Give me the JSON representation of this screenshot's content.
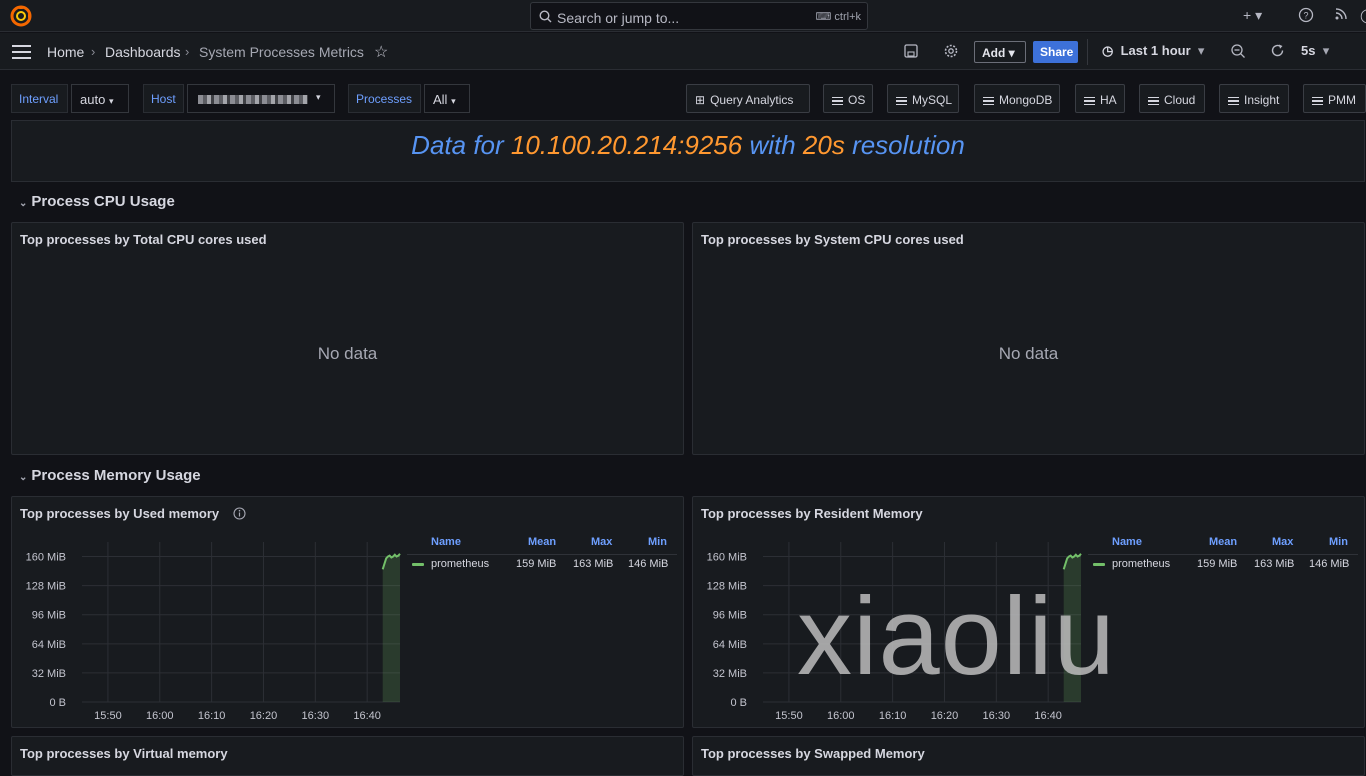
{
  "search": {
    "placeholder": "Search or jump to...",
    "shortcut": "ctrl+k"
  },
  "nav": {
    "breadcrumbs": [
      "Home",
      "Dashboards",
      "System Processes Metrics"
    ],
    "add_label": "Add",
    "share_label": "Share",
    "time_range": "Last 1 hour",
    "refresh_interval": "5s"
  },
  "variables": {
    "interval_label": "Interval",
    "interval_value": "auto",
    "host_label": "Host",
    "processes_label": "Processes",
    "processes_value": "All"
  },
  "links": [
    "Query Analytics",
    "OS",
    "MySQL",
    "MongoDB",
    "HA",
    "Cloud",
    "Insight",
    "PMM"
  ],
  "banner": {
    "part1": "Data for ",
    "host": "10.100.20.214:9256",
    "part2": " with ",
    "resolution": "20s",
    "part3": " resolution"
  },
  "rows": {
    "cpu": "Process CPU Usage",
    "memory": "Process Memory Usage"
  },
  "panels": {
    "total_cpu": {
      "title": "Top processes by Total CPU cores used",
      "empty": "No data"
    },
    "system_cpu": {
      "title": "Top processes by System CPU cores used",
      "empty": "No data"
    },
    "used_memory": {
      "title": "Top processes by Used memory"
    },
    "resident_memory": {
      "title": "Top processes by Resident Memory"
    },
    "virtual_memory": {
      "title": "Top processes by Virtual memory"
    },
    "swapped_memory": {
      "title": "Top processes by Swapped Memory"
    }
  },
  "legend": {
    "headers": [
      "Name",
      "Mean",
      "Max",
      "Min"
    ],
    "rows": [
      {
        "name": "prometheus",
        "mean": "159 MiB",
        "max": "163 MiB",
        "min": "146 MiB"
      }
    ]
  },
  "watermark": "xiaoliu",
  "colors": {
    "accent_blue": "#6e9fff",
    "series_green": "#73bf69",
    "banner_blue": "#5794f2",
    "banner_orange": "#ff9830",
    "share_blue": "#3d71d9"
  },
  "chart_data": [
    {
      "type": "area",
      "title": "Top processes by Used memory",
      "x_ticks": [
        "15:50",
        "16:00",
        "16:10",
        "16:20",
        "16:30",
        "16:40"
      ],
      "y_ticks": [
        "0 B",
        "32 MiB",
        "64 MiB",
        "96 MiB",
        "128 MiB",
        "160 MiB"
      ],
      "ylim": [
        0,
        176
      ],
      "x": [
        "16:43:00",
        "16:43:20",
        "16:43:40",
        "16:44:00",
        "16:44:20",
        "16:44:40",
        "16:45:00",
        "16:45:20",
        "16:45:40",
        "16:46:00",
        "16:46:20"
      ],
      "series": [
        {
          "name": "prometheus",
          "values": [
            146,
            152,
            158,
            160,
            161,
            159,
            160,
            162,
            160,
            161,
            163
          ]
        }
      ]
    },
    {
      "type": "area",
      "title": "Top processes by Resident Memory",
      "x_ticks": [
        "15:50",
        "16:00",
        "16:10",
        "16:20",
        "16:30",
        "16:40"
      ],
      "y_ticks": [
        "0 B",
        "32 MiB",
        "64 MiB",
        "96 MiB",
        "128 MiB",
        "160 MiB"
      ],
      "ylim": [
        0,
        176
      ],
      "x": [
        "16:43:00",
        "16:43:20",
        "16:43:40",
        "16:44:00",
        "16:44:20",
        "16:44:40",
        "16:45:00",
        "16:45:20",
        "16:45:40",
        "16:46:00",
        "16:46:20"
      ],
      "series": [
        {
          "name": "prometheus",
          "values": [
            146,
            152,
            158,
            160,
            161,
            159,
            160,
            162,
            160,
            161,
            163
          ]
        }
      ]
    }
  ]
}
